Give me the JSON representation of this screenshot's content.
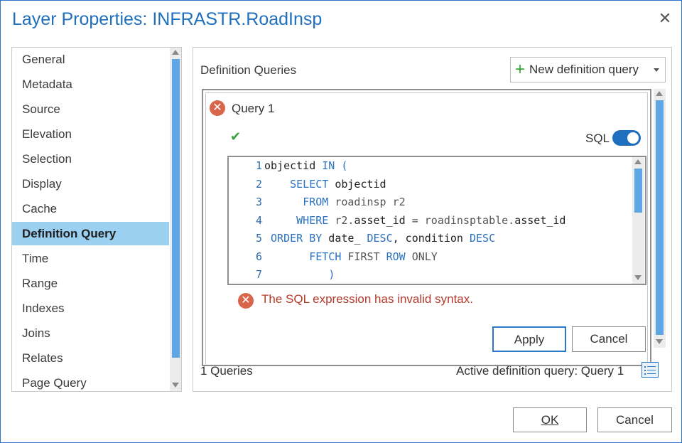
{
  "window": {
    "title": "Layer Properties: INFRASTR.RoadInsp",
    "close_icon": "close-icon"
  },
  "nav": {
    "items": [
      {
        "label": "General",
        "selected": false
      },
      {
        "label": "Metadata",
        "selected": false
      },
      {
        "label": "Source",
        "selected": false
      },
      {
        "label": "Elevation",
        "selected": false
      },
      {
        "label": "Selection",
        "selected": false
      },
      {
        "label": "Display",
        "selected": false
      },
      {
        "label": "Cache",
        "selected": false
      },
      {
        "label": "Definition Query",
        "selected": true
      },
      {
        "label": "Time",
        "selected": false
      },
      {
        "label": "Range",
        "selected": false
      },
      {
        "label": "Indexes",
        "selected": false
      },
      {
        "label": "Joins",
        "selected": false
      },
      {
        "label": "Relates",
        "selected": false
      },
      {
        "label": "Page Query",
        "selected": false
      }
    ]
  },
  "panel": {
    "heading": "Definition Queries",
    "new_query_label": "New definition query",
    "query": {
      "title": "Query 1",
      "sql_label": "SQL",
      "sql_enabled": true,
      "code_lines": [
        {
          "num": "1",
          "indent": "",
          "tokens": [
            {
              "t": "objectid",
              "c": "tx"
            },
            {
              "t": " IN (",
              "c": "kw"
            }
          ]
        },
        {
          "num": "2",
          "indent": "    ",
          "tokens": [
            {
              "t": "SELECT",
              "c": "kw"
            },
            {
              "t": " objectid",
              "c": "tx"
            }
          ]
        },
        {
          "num": "3",
          "indent": "      ",
          "tokens": [
            {
              "t": "FROM",
              "c": "kw"
            },
            {
              "t": " roadinsp r2",
              "c": "gr"
            }
          ]
        },
        {
          "num": "4",
          "indent": "     ",
          "tokens": [
            {
              "t": "WHERE",
              "c": "kw"
            },
            {
              "t": " r2.",
              "c": "gr"
            },
            {
              "t": "asset_id",
              "c": "tx"
            },
            {
              "t": " = roadinsptable.",
              "c": "gr"
            },
            {
              "t": "asset_id",
              "c": "tx"
            }
          ]
        },
        {
          "num": "5",
          "indent": " ",
          "tokens": [
            {
              "t": "ORDER BY",
              "c": "kw"
            },
            {
              "t": " date_ ",
              "c": "tx"
            },
            {
              "t": "DESC",
              "c": "kw"
            },
            {
              "t": ", condition ",
              "c": "tx"
            },
            {
              "t": "DESC",
              "c": "kw"
            }
          ]
        },
        {
          "num": "6",
          "indent": "       ",
          "tokens": [
            {
              "t": "FETCH",
              "c": "kw"
            },
            {
              "t": " FIRST ",
              "c": "gr"
            },
            {
              "t": "ROW",
              "c": "kw"
            },
            {
              "t": " ONLY",
              "c": "gr"
            }
          ]
        },
        {
          "num": "7",
          "indent": "          ",
          "tokens": [
            {
              "t": ")",
              "c": "kw"
            }
          ]
        }
      ],
      "error_message": "The SQL expression has invalid syntax.",
      "apply_label": "Apply",
      "cancel_label": "Cancel"
    },
    "query_count": "1 Queries",
    "active_query": "Active definition query: Query 1"
  },
  "buttons": {
    "ok_label": "OK",
    "cancel_label": "Cancel"
  },
  "colors": {
    "accent": "#1f6fbf",
    "selection": "#9bd0f0",
    "error": "#d9654a",
    "success": "#3aa040"
  }
}
